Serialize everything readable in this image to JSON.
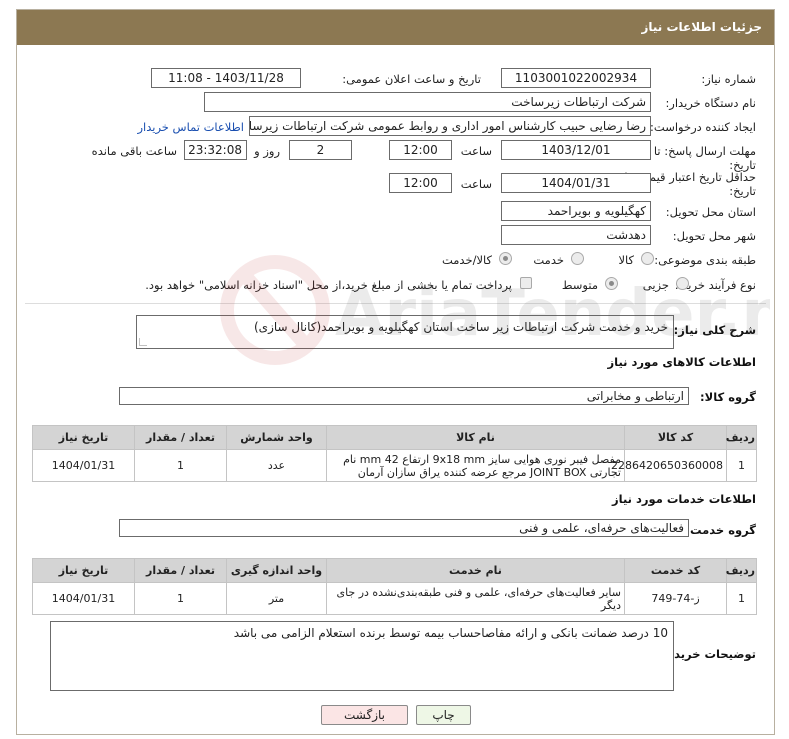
{
  "header": {
    "title": "جزئیات اطلاعات نیاز"
  },
  "fields": {
    "need_number_label": "شماره نیاز:",
    "need_number": "1103001022002934",
    "announce_label": "تاریخ و ساعت اعلان عمومی:",
    "announce_value": "1403/11/28 - 11:08",
    "buyer_org_label": "نام دستگاه خریدار:",
    "buyer_org": "شرکت ارتباطات زیرساخت",
    "creator_label": "ایجاد کننده درخواست:",
    "creator": "رضا رضایی حبیب کارشناس امور اداری و روابط عمومی شرکت ارتباطات زیرساخت",
    "contact_link": "اطلاعات تماس خریدار",
    "deadline_label": "مهلت ارسال پاسخ: تا",
    "deadline_label2": "تاریخ:",
    "deadline_date": "1403/12/01",
    "time_label": "ساعت",
    "deadline_time": "12:00",
    "days_value": "2",
    "days_label": "روز و",
    "remaining_time": "23:32:08",
    "remaining_label": "ساعت باقی مانده",
    "validity_label": "حداقل تاریخ اعتبار قیمت: تا",
    "validity_label2": "تاریخ:",
    "validity_date": "1404/01/31",
    "validity_time": "12:00",
    "province_label": "استان محل تحویل:",
    "province": "کهگیلویه و بویراحمد",
    "city_label": "شهر محل تحویل:",
    "city": "دهدشت",
    "category_label": "طبقه بندی موضوعی:",
    "category_options": [
      "کالا",
      "خدمت",
      "کالا/خدمت"
    ],
    "process_label": "نوع فرآیند خرید :",
    "process_options": [
      "جزیی",
      "متوسط"
    ],
    "payment_note": "پرداخت تمام یا بخشی از مبلغ خرید،از محل \"اسناد خزانه اسلامی\" خواهد بود."
  },
  "description": {
    "label": "شرح کلی نیاز:",
    "text": "خرید و خدمت شرکت ارتباطات زیر ساخت استان کهگیلویه و بویراحمد(کانال سازی)"
  },
  "goods": {
    "section_title": "اطلاعات کالاهای مورد نیاز",
    "group_label": "گروه کالا:",
    "group_value": "ارتباطی و مخابراتی",
    "columns": [
      "ردیف",
      "کد کالا",
      "نام کالا",
      "واحد شمارش",
      "تعداد / مقدار",
      "تاریخ نیاز"
    ],
    "rows": [
      {
        "index": "1",
        "code": "2286420650360008",
        "name": "مفصل فیبر نوری هوایی سایز 9x18 mm ارتفاع 42 mm نام تجارتی JOINT BOX مرجع عرضه کننده یراق سازان آرمان",
        "unit": "عدد",
        "qty": "1",
        "date": "1404/01/31"
      }
    ]
  },
  "services": {
    "section_title": "اطلاعات خدمات مورد نیاز",
    "group_label": "گروه خدمت:",
    "group_value": "فعالیت‌های حرفه‌ای، علمی و فنی",
    "columns": [
      "ردیف",
      "کد خدمت",
      "نام خدمت",
      "واحد اندازه گیری",
      "تعداد / مقدار",
      "تاریخ نیاز"
    ],
    "rows": [
      {
        "index": "1",
        "code": "ز-74-749",
        "name": "سایر فعالیت‌های حرفه‌ای، علمی و فنی طبقه‌بندی‌نشده در جای دیگر",
        "unit": "متر",
        "qty": "1",
        "date": "1404/01/31"
      }
    ]
  },
  "buyer_notes": {
    "label": "توضیحات خریدار:",
    "text": "10 درصد ضمانت بانکی و ارائه مفاصاحساب  بیمه توسط برنده استعلام الزامی می باشد"
  },
  "buttons": {
    "print": "چاپ",
    "back": "بازگشت"
  },
  "watermark": {
    "text": "AriaTender.neT"
  }
}
